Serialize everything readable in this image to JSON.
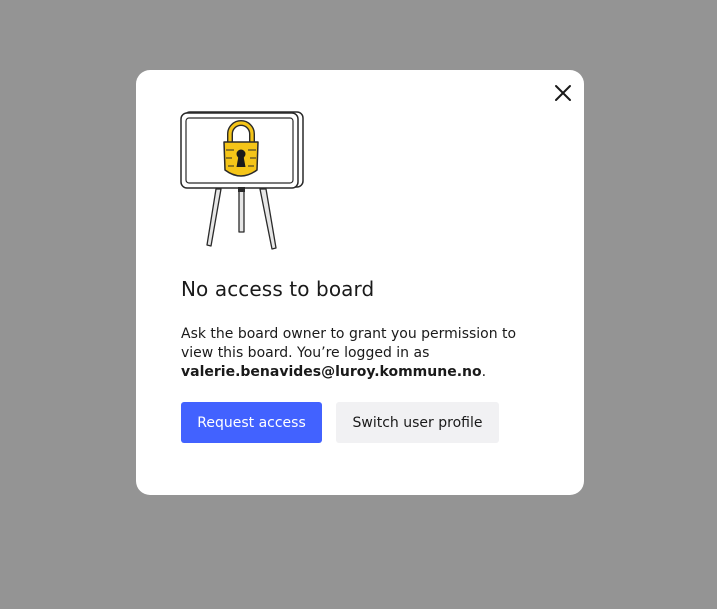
{
  "dialog": {
    "title": "No access to board",
    "message_part1": "Ask the board owner to grant you permission to view this board. You’re logged in as ",
    "email": "valerie.benavides@luroy.kommune.no",
    "message_end": ".",
    "request_button_label": "Request access",
    "switch_button_label": "Switch user profile",
    "close_icon": "close-icon",
    "illustration_icon": "locked-board-icon"
  },
  "colors": {
    "backdrop": "#949494",
    "primary": "#4262ff",
    "secondary_bg": "#f1f1f3",
    "lock_yellow": "#f5c518"
  }
}
